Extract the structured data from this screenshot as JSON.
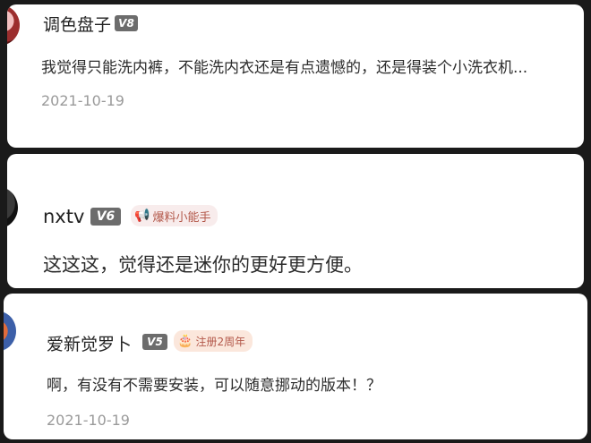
{
  "comments": [
    {
      "username": "调色盘子",
      "level": "V8",
      "text": "我觉得只能洗内裤，不能洗内衣还是有点遗憾的，还是得装个小洗衣机...",
      "date": "2021-10-19"
    },
    {
      "username": "nxtv",
      "level": "V6",
      "badge": {
        "label": "爆料小能手",
        "icon": "megaphone-icon"
      },
      "text": "这这这，觉得还是迷你的更好更方便。"
    },
    {
      "username": "爱新觉罗卜",
      "level": "V5",
      "badge": {
        "label": "注册2周年",
        "icon": "cake-icon"
      },
      "text": "啊，有没有不需要安装，可以随意挪动的版本！？",
      "date": "2021-10-19"
    }
  ],
  "colors": {
    "background": "#1a1a1a",
    "card": "#ffffff",
    "level_badge": "#6c6c6c",
    "badge_text": "#b3584a",
    "date": "#9a9a9a"
  }
}
